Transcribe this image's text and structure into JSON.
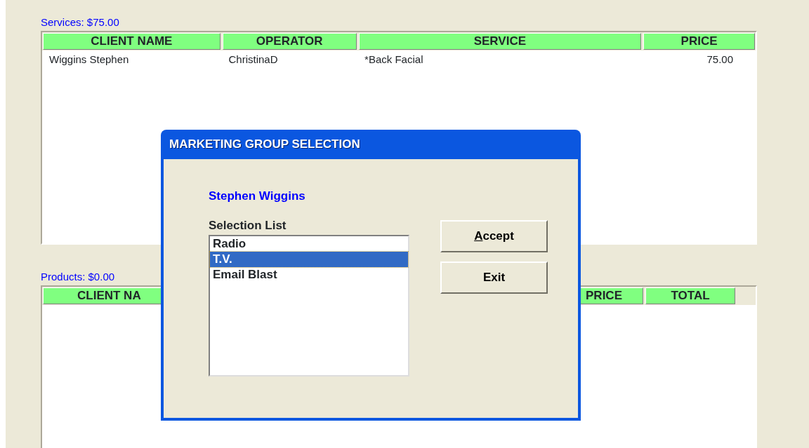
{
  "services": {
    "label": "Services: $75.00",
    "columns": [
      {
        "label": "CLIENT NAME",
        "kind": "text"
      },
      {
        "label": "OPERATOR",
        "kind": "text"
      },
      {
        "label": "SERVICE",
        "kind": "text"
      },
      {
        "label": "PRICE",
        "kind": "number"
      }
    ],
    "rows": [
      [
        "Wiggins Stephen",
        "ChristinaD",
        "*Back Facial",
        "75.00"
      ]
    ]
  },
  "products": {
    "label": "Products: $0.00",
    "columns": [
      {
        "label": "CLIENT NA"
      },
      {
        "label": "PRICE"
      },
      {
        "label": "TOTAL"
      }
    ]
  },
  "dialog": {
    "title": "MARKETING GROUP SELECTION",
    "client": "Stephen Wiggins",
    "list_label": "Selection List",
    "items": [
      {
        "label": "Radio",
        "selected": false
      },
      {
        "label": "T.V.",
        "selected": true
      },
      {
        "label": "Email Blast",
        "selected": false
      }
    ],
    "buttons": [
      {
        "label": "Accept",
        "mnemonic": true
      },
      {
        "label": "Exit",
        "mnemonic": false
      }
    ]
  }
}
